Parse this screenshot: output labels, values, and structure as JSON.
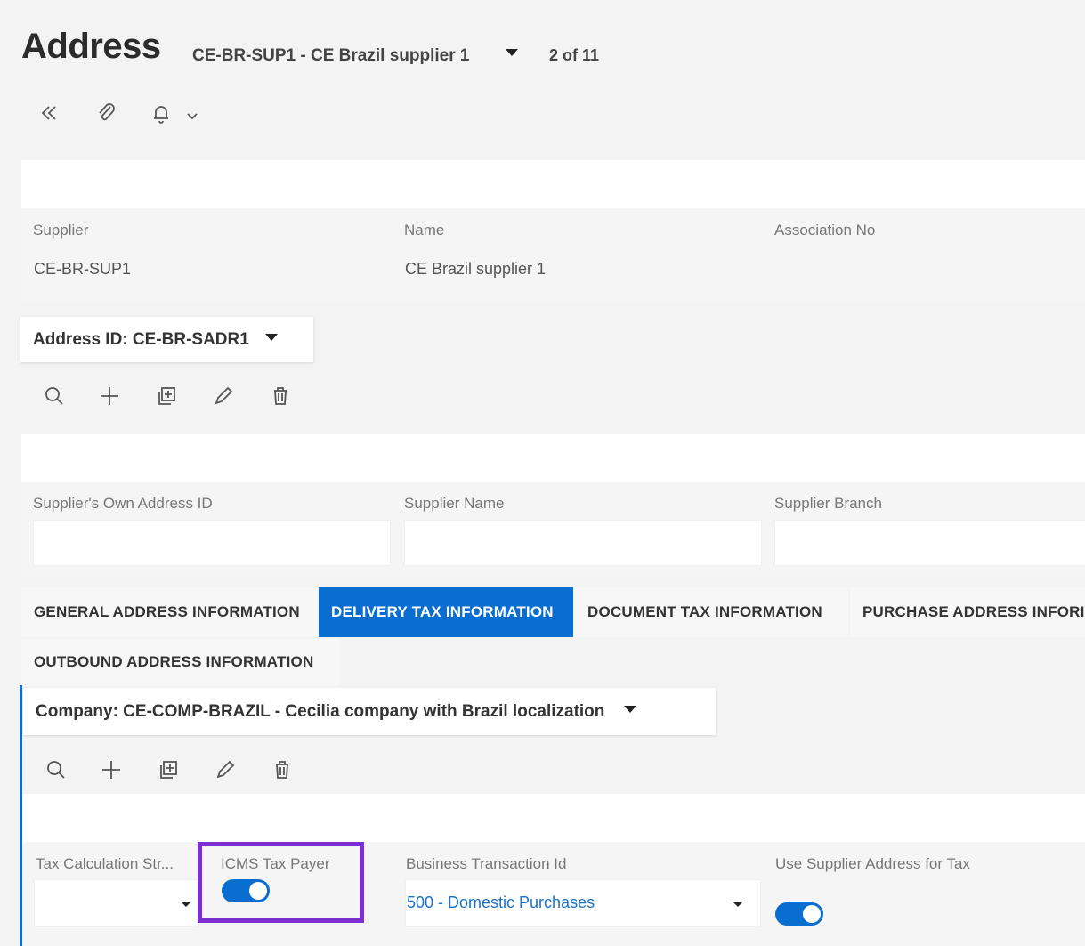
{
  "header": {
    "title": "Address",
    "record": "CE-BR-SUP1 - CE Brazil supplier 1",
    "count": "2 of 11"
  },
  "toolbar_icons": [
    "chevrons-left-icon",
    "paperclip-icon",
    "bell-icon",
    "chevron-down-icon"
  ],
  "supplier_section": {
    "fields": [
      {
        "label": "Supplier",
        "value": "CE-BR-SUP1"
      },
      {
        "label": "Name",
        "value": "CE Brazil supplier 1"
      },
      {
        "label": "Association No",
        "value": ""
      }
    ]
  },
  "address_selector": {
    "label": "Address ID: CE-BR-SADR1"
  },
  "address_fields": [
    {
      "label": "Supplier's Own Address ID",
      "value": ""
    },
    {
      "label": "Supplier Name",
      "value": ""
    },
    {
      "label": "Supplier Branch",
      "value": ""
    }
  ],
  "tabs": [
    {
      "label": "GENERAL ADDRESS INFORMATION",
      "active": false
    },
    {
      "label": "DELIVERY TAX INFORMATION",
      "active": true
    },
    {
      "label": "DOCUMENT TAX INFORMATION",
      "active": false
    },
    {
      "label": "PURCHASE ADDRESS INFORI",
      "active": false
    },
    {
      "label": "OUTBOUND ADDRESS INFORMATION",
      "active": false
    }
  ],
  "company_selector": {
    "label": "Company: CE-COMP-BRAZIL - Cecilia company with Brazil localization"
  },
  "tax_fields": {
    "tax_calc_label": "Tax Calculation Str...",
    "tax_calc_value": "",
    "icms_label": "ICMS Tax Payer",
    "icms_on": true,
    "business_label": "Business Transaction Id",
    "business_value": "500 - Domestic Purchases",
    "use_supplier_label": "Use Supplier Address for Tax",
    "use_supplier_on": true
  },
  "colors": {
    "accent": "#0a6ed1",
    "highlight": "#7b2fd0",
    "link": "#1a73c8"
  }
}
